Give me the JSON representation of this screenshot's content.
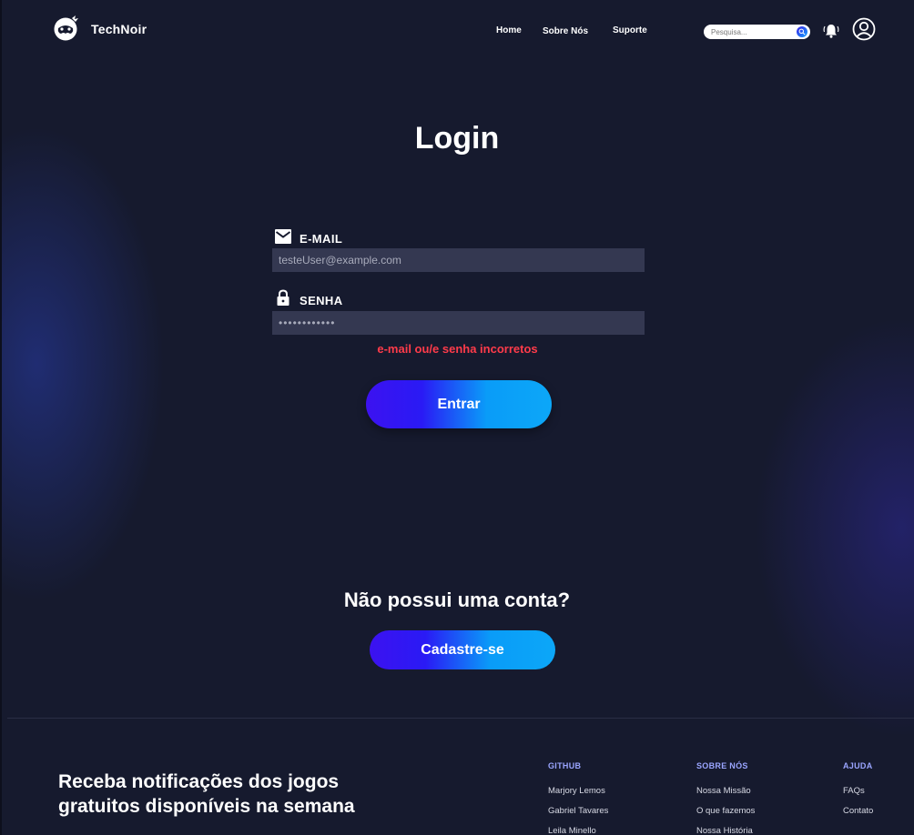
{
  "header": {
    "brand": "TechNoir",
    "nav": [
      "Home",
      "Sobre Nós",
      "Suporte"
    ],
    "search_placeholder": "Pesquisa..."
  },
  "login": {
    "title": "Login",
    "email_label": "E-MAIL",
    "email_value": "testeUser@example.com",
    "password_label": "SENHA",
    "password_value": "••••••••••••",
    "error": "e-mail ou/e senha incorretos",
    "submit": "Entrar"
  },
  "signup": {
    "prompt": "Não possui uma conta?",
    "button": "Cadastre-se"
  },
  "footer": {
    "newsletter_line1": "Receba notificações dos jogos",
    "newsletter_line2": "gratuitos disponíveis na semana",
    "columns": [
      {
        "title": "GITHUB",
        "links": [
          "Marjory Lemos",
          "Gabriel Tavares",
          "Leila Minello"
        ]
      },
      {
        "title": "SOBRE NÓS",
        "links": [
          "Nossa Missão",
          "O que fazemos",
          "Nossa História"
        ]
      },
      {
        "title": "AJUDA",
        "links": [
          "FAQs",
          "Contato"
        ]
      }
    ]
  },
  "colors": {
    "background": "#161a2e",
    "input": "#343851",
    "error": "#ff3b4a",
    "gradient_start": "#3c12f0",
    "gradient_end": "#0ca7f8",
    "footer_heading": "#9aa5ff"
  }
}
